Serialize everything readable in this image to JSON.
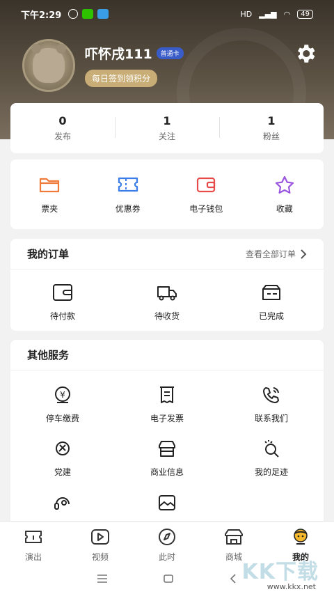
{
  "status_bar": {
    "time": "下午2:29",
    "battery": "49",
    "network": "HD"
  },
  "profile": {
    "username": "吓怀戌111",
    "member_badge": "普通卡",
    "checkin_label": "每日签到领积分"
  },
  "stats": [
    {
      "value": "0",
      "label": "发布"
    },
    {
      "value": "1",
      "label": "关注"
    },
    {
      "value": "1",
      "label": "粉丝"
    }
  ],
  "quick_actions": [
    {
      "label": "票夹",
      "icon": "folder-icon",
      "color": "#f07a3a"
    },
    {
      "label": "优惠券",
      "icon": "ticket-icon",
      "color": "#3a7de8"
    },
    {
      "label": "电子钱包",
      "icon": "wallet-icon",
      "color": "#e84a4a"
    },
    {
      "label": "收藏",
      "icon": "star-icon",
      "color": "#9a55e0"
    }
  ],
  "orders": {
    "title": "我的订单",
    "view_all": "查看全部订单",
    "items": [
      {
        "label": "待付款",
        "icon": "pending-payment-icon"
      },
      {
        "label": "待收货",
        "icon": "truck-icon"
      },
      {
        "label": "已完成",
        "icon": "completed-box-icon"
      }
    ]
  },
  "services": {
    "title": "其他服务",
    "items": [
      {
        "label": "停车缴费",
        "icon": "parking-fee-icon"
      },
      {
        "label": "电子发票",
        "icon": "invoice-icon"
      },
      {
        "label": "联系我们",
        "icon": "phone-icon"
      },
      {
        "label": "党建",
        "icon": "party-icon"
      },
      {
        "label": "商业信息",
        "icon": "store-icon"
      },
      {
        "label": "我的足迹",
        "icon": "footprint-icon"
      },
      {
        "label": "",
        "icon": "headset-icon"
      },
      {
        "label": "",
        "icon": "gallery-icon"
      }
    ]
  },
  "bottom_nav": [
    {
      "label": "演出",
      "icon": "ticket-stub-icon"
    },
    {
      "label": "视频",
      "icon": "video-play-icon"
    },
    {
      "label": "此时",
      "icon": "compass-icon"
    },
    {
      "label": "商城",
      "icon": "shop-icon"
    },
    {
      "label": "我的",
      "icon": "profile-icon",
      "active": true
    }
  ],
  "watermark": {
    "text": "KK下载",
    "url": "www.kkx.net"
  }
}
